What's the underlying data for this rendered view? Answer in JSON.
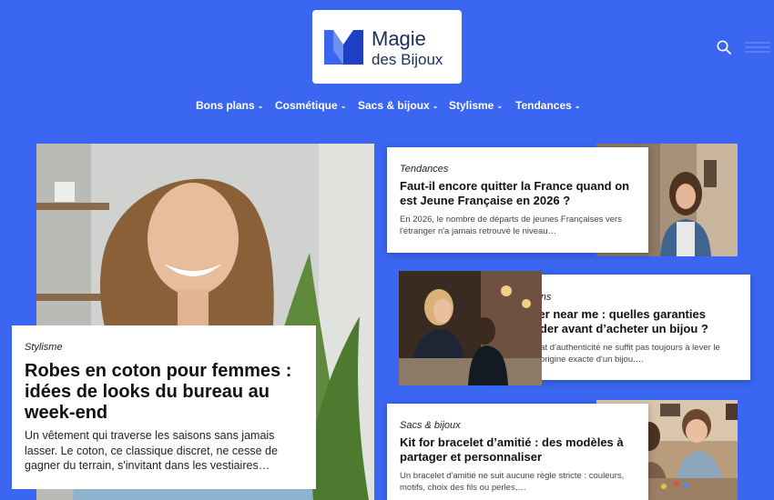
{
  "logo": {
    "line1": "Magie",
    "line2": "des Bijoux",
    "icon": "m-logo-icon"
  },
  "nav": {
    "items": [
      {
        "label": "Bons plans"
      },
      {
        "label": "Cosmétique"
      },
      {
        "label": "Sacs & bijoux"
      },
      {
        "label": "Stylisme"
      },
      {
        "label": "Tendances"
      }
    ],
    "chevron": "⌄"
  },
  "hero": {
    "category": "Stylisme",
    "title": "Robes en coton pour femmes : idées de looks du bureau au week-end",
    "excerpt": "Un vêtement qui traverse les saisons sans jamais lasser. Le coton, ce classique discret, ne cesse de gagner du terrain, s'invitant dans les vestiaires…"
  },
  "articles": [
    {
      "category": "Tendances",
      "title": "Faut-il encore quitter la France quand on est Jeune Française en 2026 ?",
      "excerpt": "En 2026, le nombre de départs de jeunes Françaises vers l'étranger n'a jamais retrouvé le niveau…"
    },
    {
      "category": "Bons plans",
      "title": "Bijoutier near me : quelles garanties demander avant d’acheter un bijou ?",
      "excerpt": "Un certificat d'authenticité ne suffit pas toujours à lever le voile sur l'origine exacte d'un bijou.…"
    },
    {
      "category": "Sacs & bijoux",
      "title": "Kit for bracelet d’amitié : des modèles à partager et personnaliser",
      "excerpt": "Un bracelet d'amitié ne suit aucune règle stricte : couleurs, motifs, choix des fils ou perles,…"
    }
  ],
  "colors": {
    "background": "#3a66f2",
    "logo_blue": "#2f5cf0"
  }
}
